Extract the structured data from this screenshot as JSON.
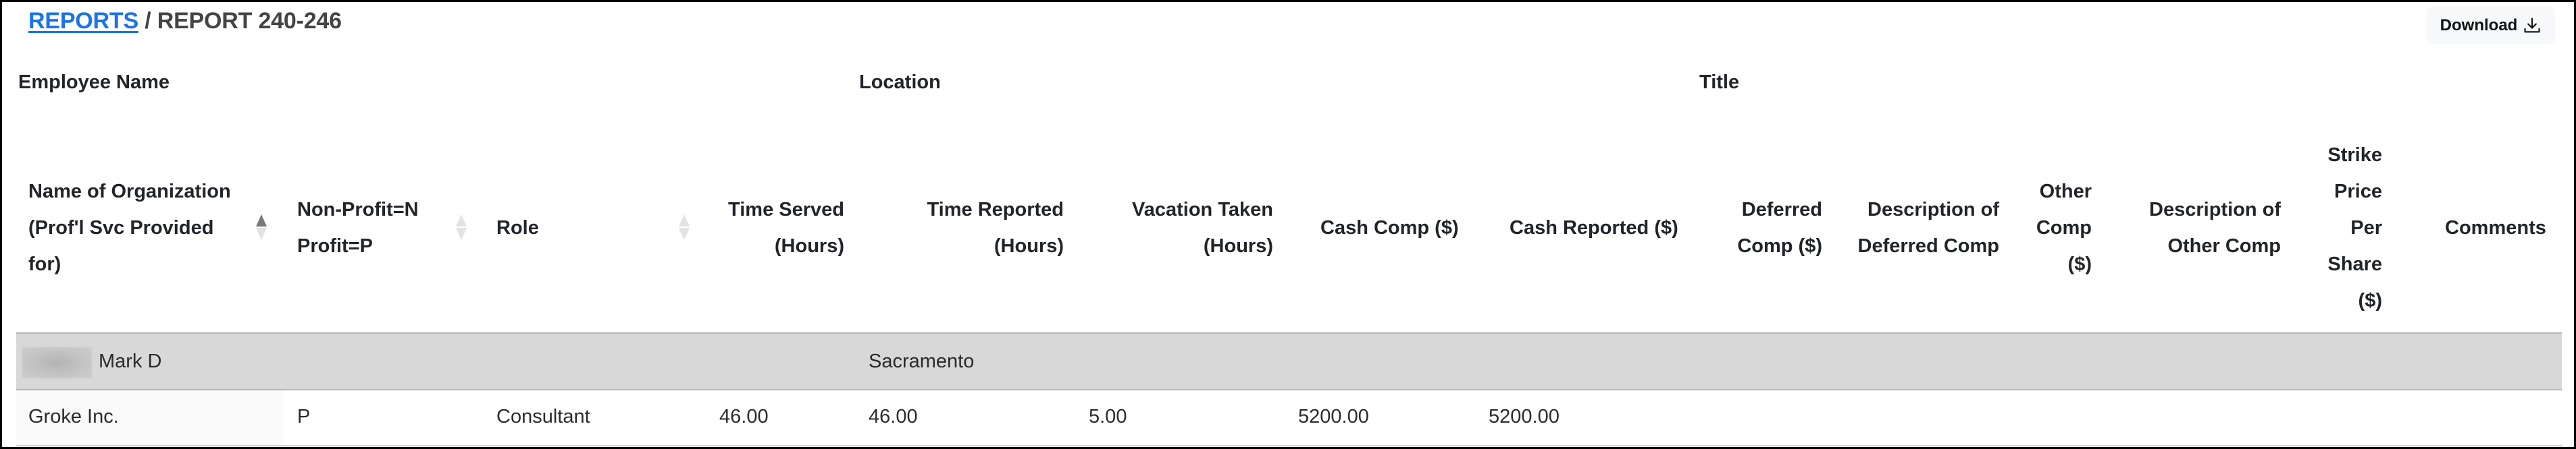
{
  "breadcrumb": {
    "root_label": "REPORTS",
    "separator": "/",
    "current": "REPORT 240-246"
  },
  "toolbar": {
    "download_label": "Download",
    "download_icon": "download-icon"
  },
  "group_headers": {
    "employee_name": "Employee Name",
    "location": "Location",
    "title": "Title"
  },
  "columns": [
    {
      "lines": [
        "Name of Organization",
        "(Prof'l Svc Provided",
        "for)"
      ],
      "sortable": true,
      "sort_state": "ascending"
    },
    {
      "lines": [
        "Non-Profit=N",
        "Profit=P"
      ],
      "sortable": true,
      "sort_state": "none"
    },
    {
      "lines": [
        "Role"
      ],
      "sortable": true,
      "sort_state": "none"
    },
    {
      "lines": [
        "Time Served",
        "(Hours)"
      ]
    },
    {
      "lines": [
        "Time Reported",
        "(Hours)"
      ]
    },
    {
      "lines": [
        "Vacation Taken",
        "(Hours)"
      ]
    },
    {
      "lines": [
        "Cash Comp ($)"
      ]
    },
    {
      "lines": [
        "Cash Reported ($)"
      ]
    },
    {
      "lines": [
        "Deferred",
        "Comp ($)"
      ]
    },
    {
      "lines": [
        "Description of",
        "Deferred Comp"
      ]
    },
    {
      "lines": [
        "Other",
        "Comp",
        "($)"
      ]
    },
    {
      "lines": [
        "Description of",
        "Other Comp"
      ]
    },
    {
      "lines": [
        "Strike",
        "Price",
        "Per",
        "Share",
        "($)"
      ]
    },
    {
      "lines": [
        "Comments"
      ]
    }
  ],
  "employee_group": {
    "name": "Mark D",
    "name_redacted_prefix": true,
    "location": "Sacramento",
    "title": ""
  },
  "rows": [
    {
      "organization": "Groke Inc.",
      "profit_type": "P",
      "role": "Consultant",
      "time_served": "46.00",
      "time_reported": "46.00",
      "vacation_taken": "5.00",
      "cash_comp": "5200.00",
      "cash_reported": "5200.00",
      "deferred_comp": "",
      "deferred_comp_description": "",
      "other_comp": "",
      "other_comp_description": "",
      "strike_price_per_share": "",
      "comments": ""
    }
  ],
  "colors": {
    "link": "#1a73e8",
    "group_row_bg": "#d8d8d8",
    "button_bg": "#f6f8fa"
  }
}
